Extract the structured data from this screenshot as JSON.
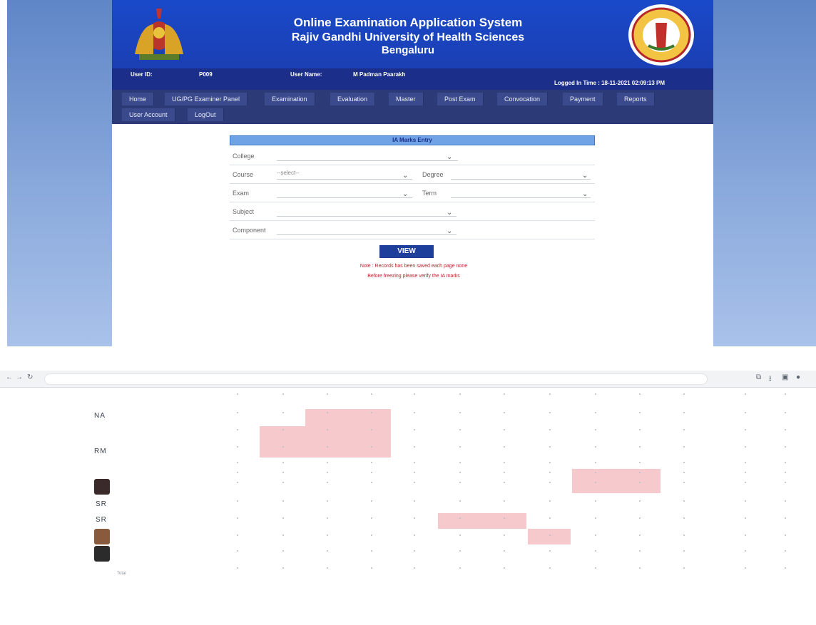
{
  "header": {
    "title_line1": "Online Examination Application System",
    "title_line2": "Rajiv Gandhi University of Health Sciences",
    "title_line3": "Bengaluru"
  },
  "user_bar": {
    "user_id_label": "User ID:",
    "user_id_value": "P009",
    "user_name_label": "User Name:",
    "user_name_value": "M Padman Paarakh",
    "logged_in": "Logged In Time : 18-11-2021 02:09:13 PM"
  },
  "nav": {
    "items": [
      "Home",
      "UG/PG Examiner Panel",
      "Examination",
      "Evaluation",
      "Master",
      "Post Exam",
      "Convocation",
      "Payment",
      "Reports",
      "User Account",
      "LogOut"
    ]
  },
  "ia_form": {
    "title": "IA Marks Entry",
    "college_label": "College",
    "course_label": "Course",
    "course_value": "--select--",
    "degree_label": "Degree",
    "exam_label": "Exam",
    "term_label": "Term",
    "subject_label": "Subject",
    "component_label": "Component",
    "view_label": "VIEW",
    "note1": "Note : Records has been saved each page none",
    "note2": "Before freezing please verify the IA marks"
  },
  "sheet": {
    "avatars": [
      "NA",
      "RM",
      "SR",
      "SR"
    ],
    "footer_label": "Total"
  },
  "colors": {
    "header_blue": "#1a49c9",
    "nav_blue": "#2c3a78",
    "view_button": "#1e3e9c",
    "note_red": "#b7262c",
    "highlight_pink": "#f6c9cc"
  }
}
